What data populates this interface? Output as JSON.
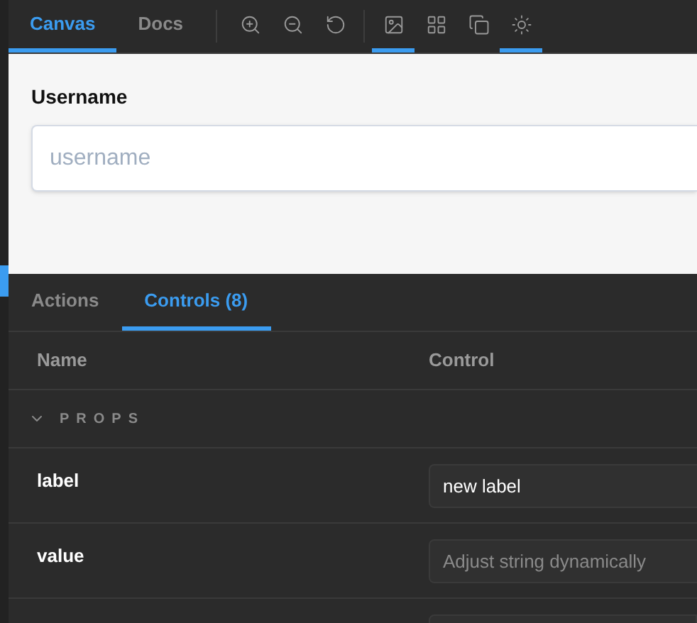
{
  "tabs": [
    {
      "label": "Canvas",
      "selected": true
    },
    {
      "label": "Docs",
      "selected": false
    }
  ],
  "tools": [
    {
      "kind": "zoom-in",
      "selected": false
    },
    {
      "kind": "zoom-out",
      "selected": false
    },
    {
      "kind": "reset",
      "selected": false
    },
    {
      "kind": "divider"
    },
    {
      "kind": "background",
      "selected": true
    },
    {
      "kind": "grid",
      "selected": false
    },
    {
      "kind": "outline",
      "selected": false
    },
    {
      "kind": "theme",
      "selected": true
    }
  ],
  "canvas": {
    "label": "Username",
    "placeholder": "username"
  },
  "panel_tabs": [
    {
      "label": "Actions",
      "selected": false
    },
    {
      "label": "Controls (8)",
      "selected": true
    }
  ],
  "table": {
    "columns": [
      "Name",
      "Control"
    ],
    "section": {
      "label": "PROPS",
      "expanded": true
    },
    "rows": [
      {
        "name": "label",
        "value": "new label"
      },
      {
        "name": "value",
        "placeholder": "Adjust string dynamically"
      }
    ]
  }
}
